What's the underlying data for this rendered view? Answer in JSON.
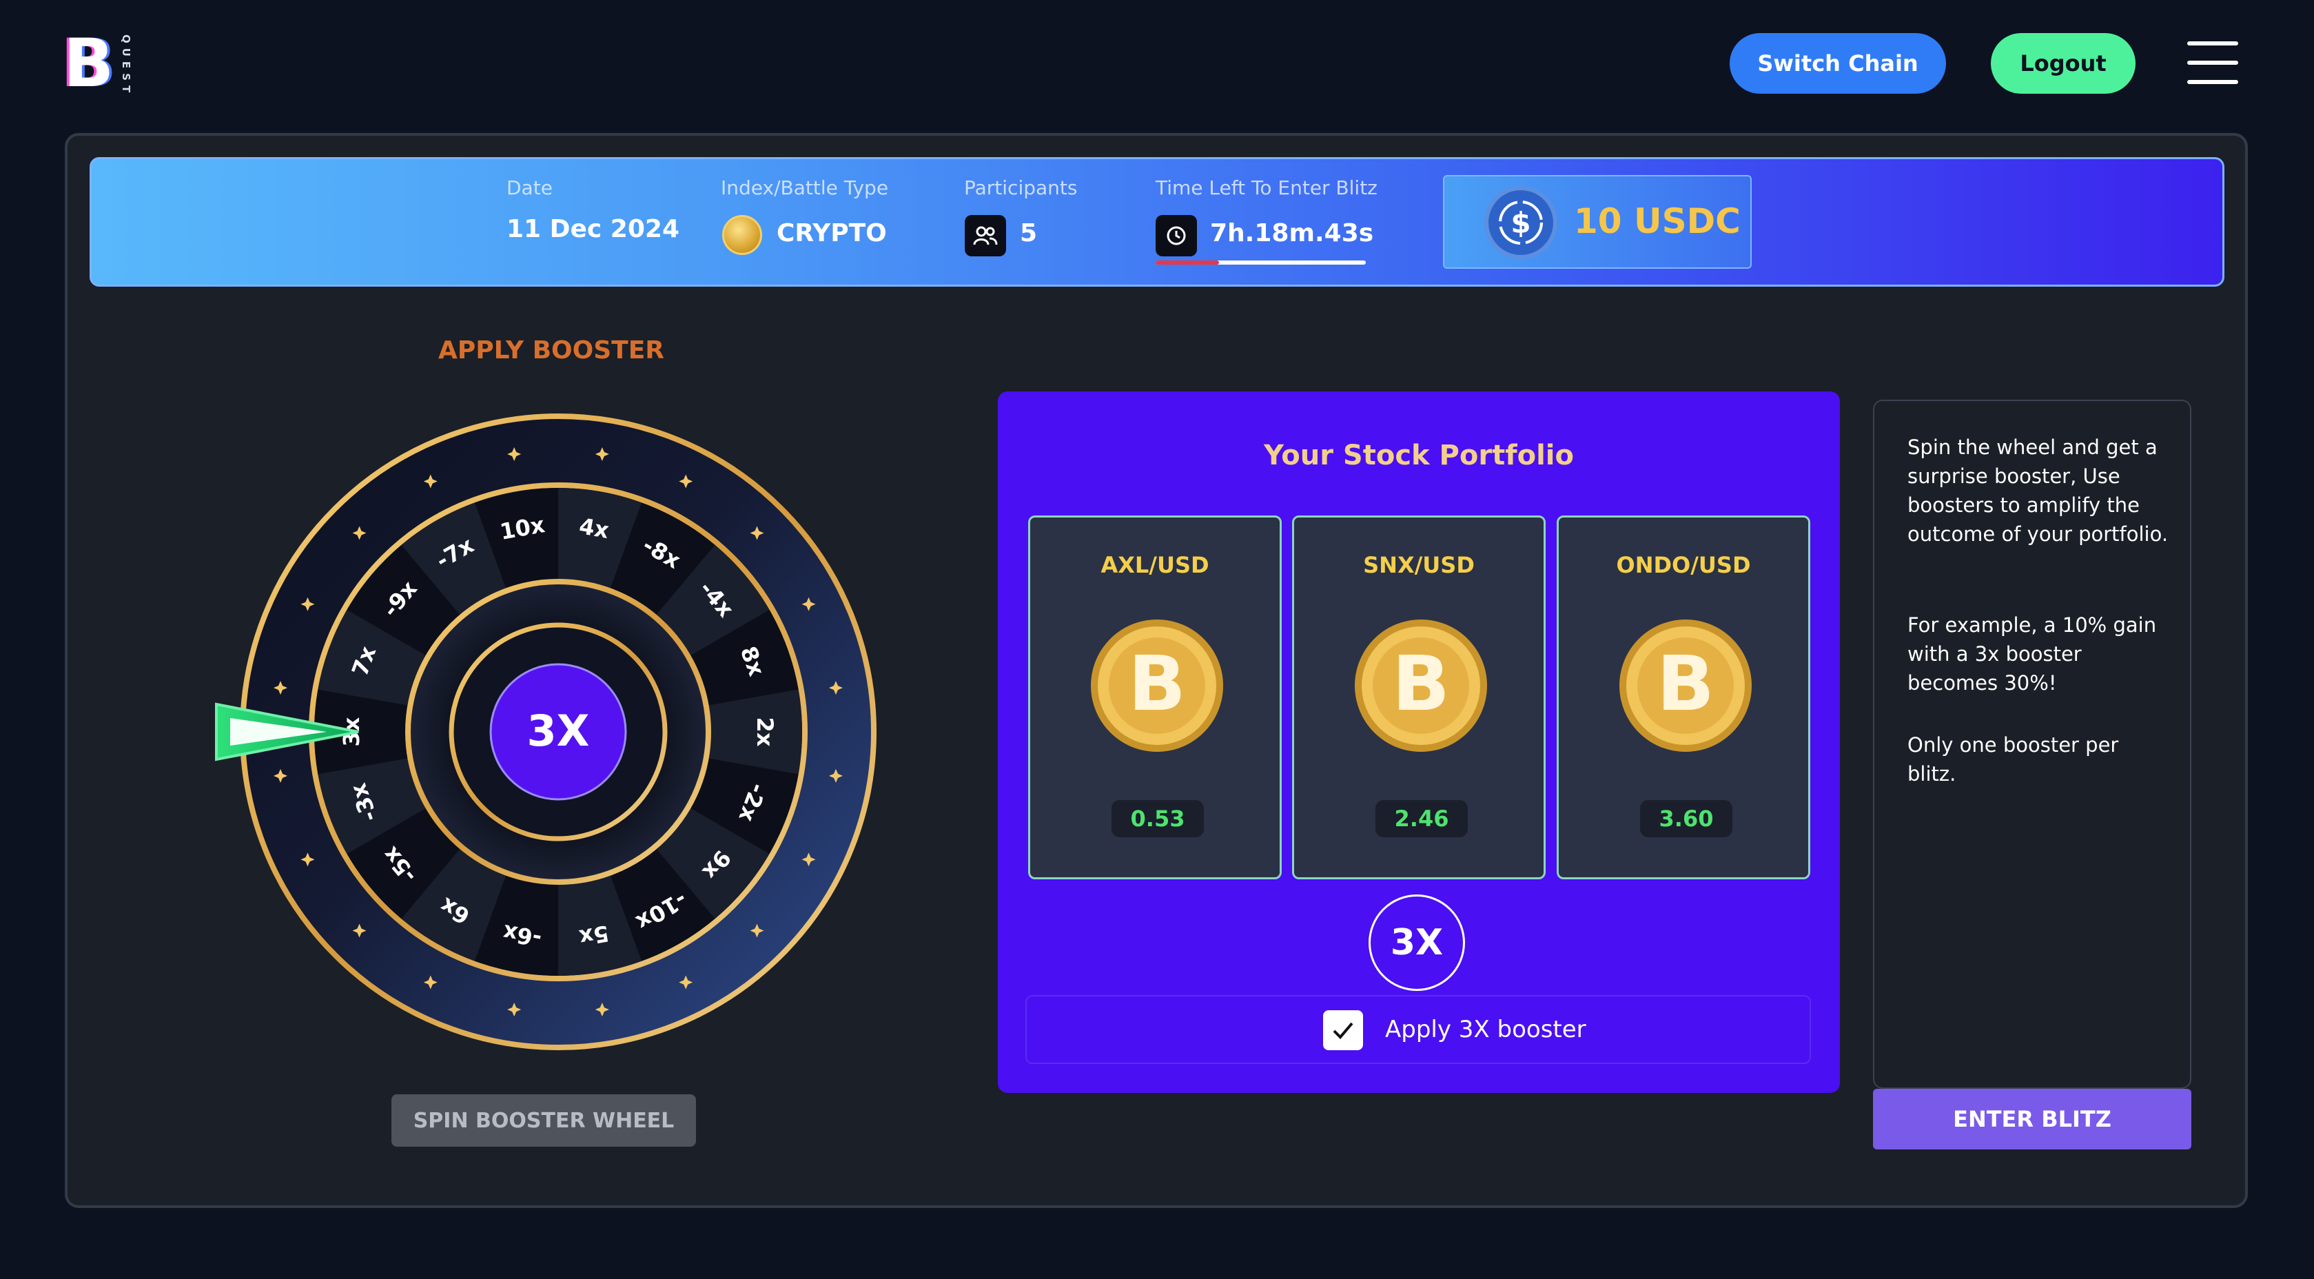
{
  "brand": {
    "logo_letter": "B",
    "logo_sub": "QUEST"
  },
  "nav": {
    "switch_chain": "Switch Chain",
    "logout": "Logout",
    "menu_icon": "hamburger-menu-icon"
  },
  "blitz_info": {
    "date_label": "Date",
    "date_value": "11 Dec 2024",
    "type_label": "Index/Battle Type",
    "type_value": "CRYPTO",
    "participants_label": "Participants",
    "participants_value": "5",
    "time_label": "Time Left To Enter Blitz",
    "time_value": "7h.18m.43s",
    "time_progress": 0.3,
    "prize_value": "10 USDC",
    "prize_icon": "usdc-dollar-icon"
  },
  "booster": {
    "title": "APPLY BOOSTER",
    "center_value": "3X",
    "spin_label": "SPIN BOOSTER WHEEL",
    "segments": [
      "3x",
      "7x",
      "-9x",
      "-7x",
      "10x",
      "4x",
      "-8x",
      "-4x",
      "8x",
      "2x",
      "-2x",
      "9x",
      "-10x",
      "5x",
      "-6x",
      "6x",
      "-5x",
      "-3x"
    ]
  },
  "portfolio": {
    "title": "Your Stock Portfolio",
    "stocks": [
      {
        "symbol": "AXL/USD",
        "value": "0.53"
      },
      {
        "symbol": "SNX/USD",
        "value": "2.46"
      },
      {
        "symbol": "ONDO/USD",
        "value": "3.60"
      }
    ],
    "booster_value": "3X",
    "apply_label": "Apply 3X booster",
    "apply_checked": true
  },
  "description": {
    "p1": "Spin the wheel and get a surprise booster, Use boosters to amplify the outcome of your portfolio.",
    "p2": "For example, a 10% gain with a 3x booster becomes 30%!",
    "p3": "Only one booster per blitz."
  },
  "enter_label": "ENTER BLITZ",
  "colors": {
    "background": "#0d1220",
    "switch_chain": "#2f7cf6",
    "logout": "#4ef19b",
    "portfolio_bg": "#4a0ff2",
    "prize_gold": "#f5c64a",
    "booster_title": "#d86f2c",
    "enter_button": "#7a5ae8",
    "positive_value": "#4ee36f"
  }
}
